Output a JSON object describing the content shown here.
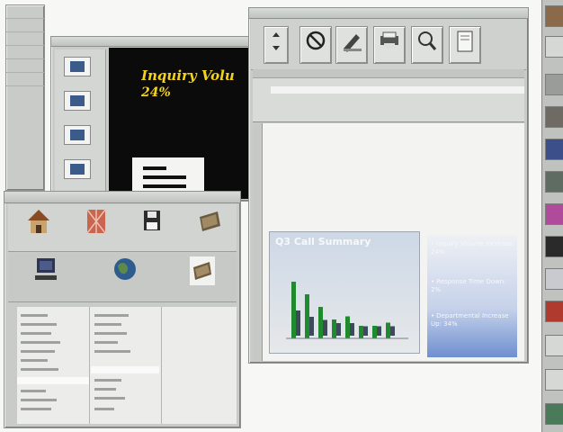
{
  "presentation": {
    "title": "Inquiry Volu",
    "subtitle": "24%"
  },
  "report": {
    "chart": {
      "title": "Q3 Call Summary"
    }
  },
  "bullets": [
    {
      "label": "Inquiry Volume Increase: 24%"
    },
    {
      "label": "Response Time Down: 2%"
    },
    {
      "label": "Departmental Increase Up: 34%"
    }
  ],
  "icons": {
    "toolbar": [
      "arrows-icon",
      "stop-icon",
      "edit-icon",
      "print-icon",
      "magnifier-icon",
      "book-icon"
    ],
    "file_manager_row1": [
      "house-icon",
      "network-icon",
      "floppy-icon",
      "folder-icon"
    ],
    "file_manager_row2": [
      "computer-icon",
      "globe-icon",
      "folder-icon"
    ]
  },
  "chart_data": {
    "type": "bar",
    "title": "Q3 Call Summary",
    "categories": [
      "1",
      "2",
      "3",
      "4",
      "5",
      "6",
      "7",
      "8"
    ],
    "series": [
      {
        "values": [
          9,
          7,
          5,
          3,
          3.5,
          2,
          2,
          2.5
        ]
      },
      {
        "values": [
          4,
          3,
          2.5,
          2,
          2,
          1.5,
          1.5,
          1.5
        ]
      }
    ],
    "ylim": [
      0,
      10
    ],
    "colors": {
      "primary": "#1f8a2e",
      "secondary": "#3d4a5a"
    }
  },
  "colors": {
    "slide_bg": "#0b0b0b",
    "slide_title": "#f3d21c",
    "bar_green": "#1f8a2e",
    "bullet_panel": "#6e8fcf"
  }
}
